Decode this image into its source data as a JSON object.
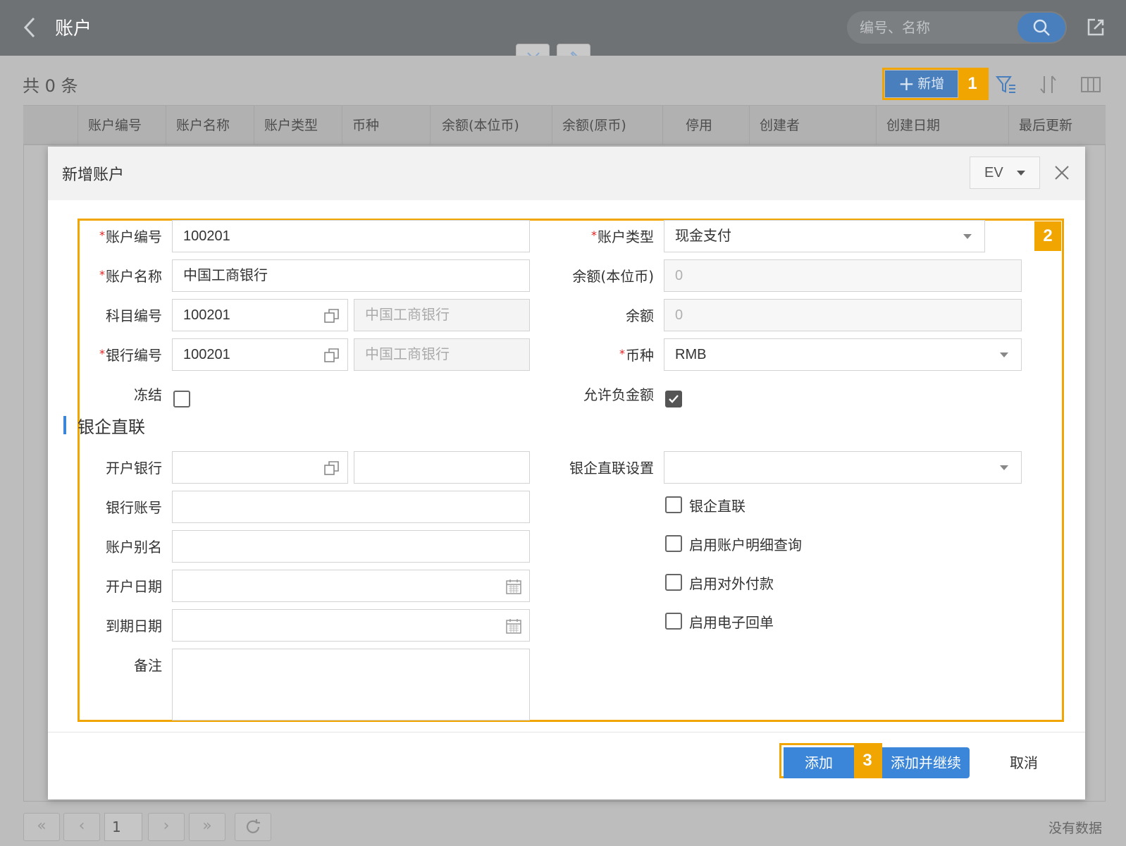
{
  "header": {
    "title": "账户",
    "search_placeholder": "编号、名称"
  },
  "toolbar": {
    "count_label": "共 0 条",
    "add_label": "新增",
    "callout_1": "1"
  },
  "grid": {
    "columns": [
      "账户编号",
      "账户名称",
      "账户类型",
      "币种",
      "余额(本位币)",
      "余额(原币)",
      "停用",
      "创建者",
      "创建日期",
      "最后更新"
    ]
  },
  "pagination": {
    "first": "«",
    "prev": "‹",
    "page": "1",
    "next": "›",
    "last": "»",
    "status": "没有数据"
  },
  "modal": {
    "title": "新增账户",
    "language": "EV",
    "callout_2": "2",
    "callout_3": "3",
    "fields": {
      "account_no": {
        "label": "账户编号",
        "value": "100201",
        "required": true
      },
      "account_name": {
        "label": "账户名称",
        "value": "中国工商银行",
        "required": true
      },
      "subject_no": {
        "label": "科目编号",
        "value": "100201",
        "desc": "中国工商银行"
      },
      "bank_no": {
        "label": "银行编号",
        "value": "100201",
        "desc": "中国工商银行",
        "required": true
      },
      "frozen": {
        "label": "冻结",
        "checked": false
      },
      "account_type": {
        "label": "账户类型",
        "value": "现金支付",
        "required": true
      },
      "balance_base": {
        "label": "余额(本位币)",
        "value": "0"
      },
      "balance": {
        "label": "余额",
        "value": "0"
      },
      "currency": {
        "label": "币种",
        "value": "RMB",
        "required": true
      },
      "allow_negative": {
        "label": "允许负金额",
        "checked": true
      }
    },
    "section_title": "银企直联",
    "bank_fields": {
      "open_bank": {
        "label": "开户银行",
        "value": "",
        "desc": ""
      },
      "bank_account": {
        "label": "银行账号",
        "value": ""
      },
      "account_alias": {
        "label": "账户别名",
        "value": ""
      },
      "open_date": {
        "label": "开户日期",
        "value": ""
      },
      "expire_date": {
        "label": "到期日期",
        "value": ""
      },
      "remark": {
        "label": "备注",
        "value": ""
      },
      "direct_setting": {
        "label": "银企直联设置",
        "value": ""
      }
    },
    "options": [
      {
        "label": "银企直联",
        "checked": false
      },
      {
        "label": "启用账户明细查询",
        "checked": false
      },
      {
        "label": "启用对外付款",
        "checked": false
      },
      {
        "label": "启用电子回单",
        "checked": false
      }
    ],
    "footer": {
      "add": "添加",
      "add_continue": "添加并继续",
      "cancel": "取消"
    }
  },
  "colors": {
    "primary": "#3b86d8",
    "highlight": "#f0a500",
    "required": "#e02020"
  }
}
